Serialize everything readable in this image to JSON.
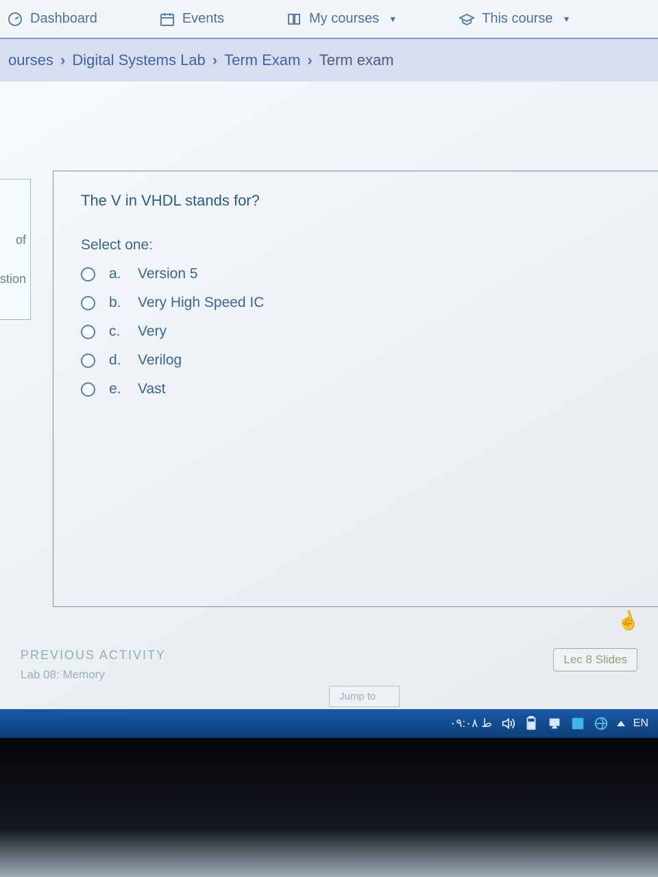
{
  "topnav": {
    "dashboard": "Dashboard",
    "events": "Events",
    "my_courses": "My courses",
    "this_course": "This course"
  },
  "crumbs": {
    "c0": "ourses",
    "c1": "Digital Systems Lab",
    "c2": "Term Exam",
    "c3": "Term exam"
  },
  "sidebar": {
    "of": "of",
    "stion": "stion"
  },
  "question": {
    "text": "The V in VHDL stands for?",
    "select": "Select one:",
    "opts": [
      {
        "letter": "a.",
        "label": "Version 5"
      },
      {
        "letter": "b.",
        "label": "Very High Speed IC"
      },
      {
        "letter": "c.",
        "label": "Very"
      },
      {
        "letter": "d.",
        "label": "Verilog"
      },
      {
        "letter": "e.",
        "label": "Vast"
      }
    ]
  },
  "footer": {
    "prev_label": "PREVIOUS ACTIVITY",
    "prev_link": "Lab 08: Memory",
    "lec_pill": "Lec 8 Slides",
    "jump": "Jump to"
  },
  "taskbar": {
    "lang": "EN",
    "clock": "ط ٠٩:٠٨"
  }
}
